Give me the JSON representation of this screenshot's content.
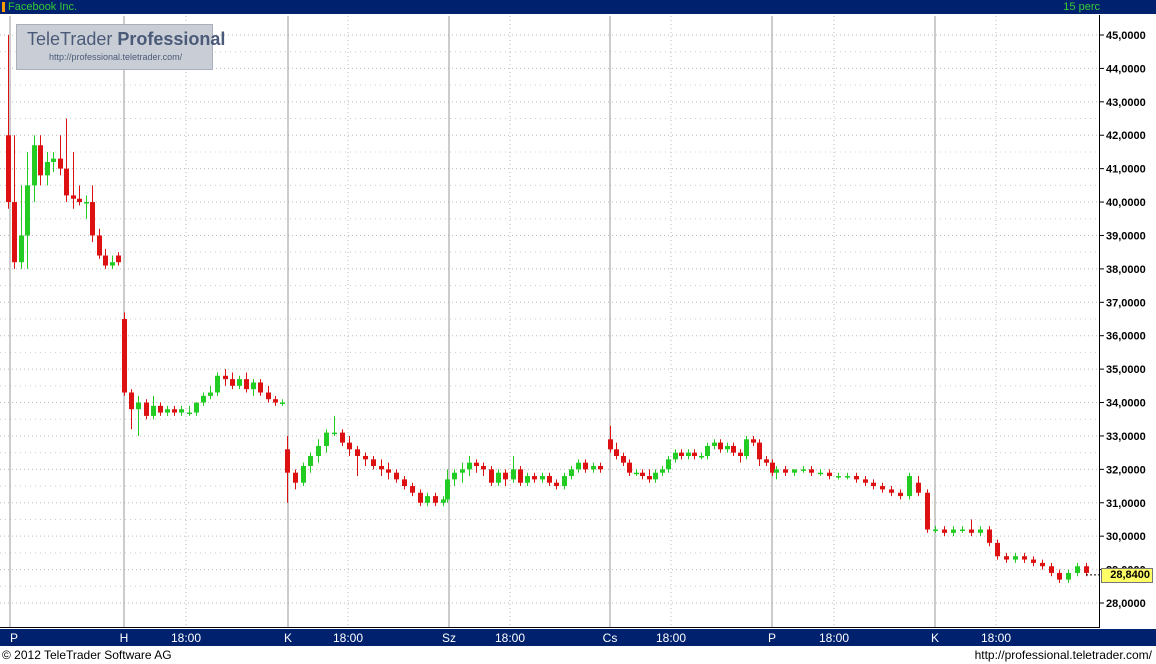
{
  "header": {
    "symbol": "Facebook Inc.",
    "interval": "15 perc"
  },
  "footer": {
    "copyright": "© 2012 TeleTrader Software AG",
    "url": "http://professional.teletrader.com/"
  },
  "logo": {
    "brand_light": "TeleTrader",
    "brand_bold": "Professional",
    "url": "http://professional.teletrader.com/"
  },
  "colors": {
    "frame": "#00226e",
    "up": "#22cc22",
    "down": "#dd1111",
    "label": "#33cc33",
    "last_bg": "#ffff66"
  },
  "chart_data": {
    "type": "candlestick",
    "title": "Facebook Inc.",
    "interval": "15 perc",
    "ylim": [
      27.3,
      45.4
    ],
    "y_ticks": [
      "45,0000",
      "44,0000",
      "43,0000",
      "42,0000",
      "41,0000",
      "40,0000",
      "39,0000",
      "38,0000",
      "37,0000",
      "36,0000",
      "35,0000",
      "34,0000",
      "33,0000",
      "32,0000",
      "31,0000",
      "30,0000",
      "29,0000",
      "28,0000"
    ],
    "x_labels": [
      "P",
      "H",
      "18:00",
      "K",
      "18:00",
      "Sz",
      "18:00",
      "Cs",
      "18:00",
      "P",
      "18:00",
      "K",
      "18:00"
    ],
    "last_value": "28,8400",
    "grid": true,
    "ohlc": [
      [
        42.0,
        45.0,
        39.8,
        40.0
      ],
      [
        40.0,
        42.0,
        38.0,
        38.2
      ],
      [
        38.2,
        40.5,
        38.0,
        39.0
      ],
      [
        39.0,
        41.5,
        38.0,
        40.5
      ],
      [
        40.5,
        42.0,
        40.0,
        41.7
      ],
      [
        41.7,
        42.0,
        40.5,
        40.8
      ],
      [
        40.8,
        41.5,
        40.5,
        41.2
      ],
      [
        41.2,
        41.5,
        40.9,
        41.3
      ],
      [
        41.3,
        42.0,
        40.8,
        41.0
      ],
      [
        41.0,
        42.5,
        40.0,
        40.2
      ],
      [
        40.2,
        41.5,
        39.8,
        40.1
      ],
      [
        40.1,
        40.5,
        39.9,
        40.0
      ],
      [
        40.0,
        40.2,
        39.5,
        40.0
      ],
      [
        40.0,
        40.5,
        38.8,
        39.0
      ],
      [
        39.0,
        39.2,
        38.3,
        38.4
      ],
      [
        38.4,
        38.6,
        38.0,
        38.1
      ],
      [
        38.1,
        38.4,
        38.0,
        38.2
      ],
      [
        38.4,
        38.5,
        38.1,
        38.2
      ],
      [
        36.5,
        36.7,
        34.2,
        34.3
      ],
      [
        34.3,
        34.4,
        33.2,
        33.8
      ],
      [
        33.8,
        34.2,
        33.0,
        34.0
      ],
      [
        34.0,
        34.1,
        33.5,
        33.6
      ],
      [
        33.6,
        34.2,
        33.5,
        33.9
      ],
      [
        33.9,
        34.0,
        33.6,
        33.7
      ],
      [
        33.7,
        33.9,
        33.6,
        33.8
      ],
      [
        33.8,
        33.9,
        33.6,
        33.7
      ],
      [
        33.7,
        33.9,
        33.6,
        33.8
      ],
      [
        33.7,
        33.9,
        33.6,
        33.7
      ],
      [
        33.7,
        34.0,
        33.6,
        34.0
      ],
      [
        34.0,
        34.3,
        33.9,
        34.2
      ],
      [
        34.2,
        34.5,
        34.1,
        34.3
      ],
      [
        34.3,
        34.9,
        34.2,
        34.8
      ],
      [
        34.8,
        35.0,
        34.5,
        34.7
      ],
      [
        34.7,
        34.9,
        34.4,
        34.5
      ],
      [
        34.5,
        34.8,
        34.4,
        34.7
      ],
      [
        34.7,
        34.9,
        34.3,
        34.4
      ],
      [
        34.4,
        34.7,
        34.2,
        34.6
      ],
      [
        34.6,
        34.7,
        34.2,
        34.3
      ],
      [
        34.3,
        34.5,
        34.0,
        34.1
      ],
      [
        34.1,
        34.2,
        33.9,
        34.0
      ],
      [
        34.0,
        34.1,
        33.9,
        34.0
      ],
      [
        32.6,
        33.0,
        31.0,
        31.9
      ],
      [
        31.9,
        32.0,
        31.4,
        31.6
      ],
      [
        31.6,
        32.2,
        31.5,
        32.1
      ],
      [
        32.1,
        32.5,
        31.9,
        32.4
      ],
      [
        32.4,
        32.9,
        32.2,
        32.7
      ],
      [
        32.7,
        33.2,
        32.5,
        33.1
      ],
      [
        33.1,
        33.6,
        33.0,
        33.1
      ],
      [
        33.1,
        33.2,
        32.7,
        32.8
      ],
      [
        32.8,
        33.0,
        32.4,
        32.6
      ],
      [
        32.6,
        32.7,
        31.8,
        32.4
      ],
      [
        32.4,
        32.5,
        32.1,
        32.3
      ],
      [
        32.3,
        32.4,
        32.0,
        32.1
      ],
      [
        32.1,
        32.3,
        31.8,
        32.0
      ],
      [
        32.0,
        32.2,
        31.7,
        31.9
      ],
      [
        31.9,
        32.0,
        31.6,
        31.7
      ],
      [
        31.7,
        31.8,
        31.4,
        31.5
      ],
      [
        31.5,
        31.6,
        31.2,
        31.3
      ],
      [
        31.3,
        31.4,
        30.9,
        31.0
      ],
      [
        31.0,
        31.3,
        30.9,
        31.2
      ],
      [
        31.2,
        31.3,
        30.9,
        31.0
      ],
      [
        31.0,
        31.2,
        30.9,
        31.1
      ],
      [
        31.1,
        32.0,
        31.0,
        31.7
      ],
      [
        31.7,
        32.0,
        31.5,
        31.9
      ],
      [
        31.9,
        32.2,
        31.6,
        32.0
      ],
      [
        32.0,
        32.4,
        31.8,
        32.2
      ],
      [
        32.2,
        32.3,
        31.9,
        32.1
      ],
      [
        32.1,
        32.2,
        31.8,
        32.0
      ],
      [
        32.0,
        32.1,
        31.5,
        31.6
      ],
      [
        31.6,
        32.0,
        31.5,
        31.9
      ],
      [
        31.9,
        32.0,
        31.5,
        31.7
      ],
      [
        31.7,
        32.4,
        31.6,
        32.0
      ],
      [
        32.0,
        32.1,
        31.5,
        31.6
      ],
      [
        31.6,
        31.9,
        31.5,
        31.8
      ],
      [
        31.8,
        31.9,
        31.6,
        31.7
      ],
      [
        31.7,
        31.9,
        31.6,
        31.8
      ],
      [
        31.8,
        31.9,
        31.5,
        31.6
      ],
      [
        31.6,
        31.7,
        31.4,
        31.5
      ],
      [
        31.5,
        31.9,
        31.4,
        31.8
      ],
      [
        31.8,
        32.1,
        31.7,
        32.0
      ],
      [
        32.0,
        32.3,
        31.9,
        32.2
      ],
      [
        32.2,
        32.3,
        31.9,
        32.0
      ],
      [
        32.0,
        32.2,
        31.9,
        32.1
      ],
      [
        32.1,
        32.2,
        31.9,
        32.0
      ],
      [
        32.9,
        33.3,
        32.5,
        32.6
      ],
      [
        32.6,
        32.8,
        32.3,
        32.4
      ],
      [
        32.4,
        32.5,
        32.1,
        32.2
      ],
      [
        32.2,
        32.3,
        31.8,
        31.9
      ],
      [
        31.9,
        32.0,
        31.8,
        31.9
      ],
      [
        31.9,
        32.0,
        31.7,
        31.8
      ],
      [
        31.8,
        32.0,
        31.6,
        31.7
      ],
      [
        31.7,
        32.0,
        31.6,
        31.9
      ],
      [
        31.9,
        32.1,
        31.8,
        32.0
      ],
      [
        32.0,
        32.4,
        31.9,
        32.3
      ],
      [
        32.3,
        32.6,
        32.2,
        32.5
      ],
      [
        32.5,
        32.6,
        32.3,
        32.4
      ],
      [
        32.4,
        32.6,
        32.3,
        32.5
      ],
      [
        32.5,
        32.6,
        32.3,
        32.4
      ],
      [
        32.4,
        32.5,
        32.3,
        32.4
      ],
      [
        32.4,
        32.8,
        32.3,
        32.7
      ],
      [
        32.7,
        32.9,
        32.6,
        32.8
      ],
      [
        32.8,
        32.9,
        32.5,
        32.6
      ],
      [
        32.6,
        32.8,
        32.5,
        32.7
      ],
      [
        32.7,
        32.8,
        32.4,
        32.5
      ],
      [
        32.5,
        32.6,
        32.2,
        32.4
      ],
      [
        32.4,
        33.0,
        32.3,
        32.9
      ],
      [
        32.9,
        33.0,
        32.7,
        32.8
      ],
      [
        32.8,
        32.9,
        32.1,
        32.3
      ],
      [
        32.3,
        32.4,
        32.1,
        32.2
      ],
      [
        32.2,
        32.3,
        31.8,
        31.9
      ],
      [
        31.9,
        32.1,
        31.7,
        32.0
      ],
      [
        32.0,
        32.1,
        31.8,
        31.9
      ],
      [
        31.9,
        32.0,
        31.8,
        32.0
      ],
      [
        32.0,
        32.1,
        31.9,
        32.0
      ],
      [
        32.0,
        32.1,
        31.8,
        31.9
      ],
      [
        31.9,
        32.0,
        31.8,
        31.9
      ],
      [
        31.9,
        32.0,
        31.7,
        31.8
      ],
      [
        31.8,
        31.9,
        31.7,
        31.8
      ],
      [
        31.8,
        31.9,
        31.7,
        31.8
      ],
      [
        31.8,
        31.9,
        31.6,
        31.7
      ],
      [
        31.7,
        31.8,
        31.5,
        31.6
      ],
      [
        31.6,
        31.7,
        31.4,
        31.5
      ],
      [
        31.5,
        31.6,
        31.3,
        31.4
      ],
      [
        31.4,
        31.5,
        31.2,
        31.3
      ],
      [
        31.3,
        31.4,
        31.1,
        31.2
      ],
      [
        31.2,
        31.9,
        31.1,
        31.8
      ],
      [
        31.6,
        31.8,
        31.2,
        31.3
      ],
      [
        31.3,
        31.4,
        30.1,
        30.2
      ],
      [
        30.2,
        30.3,
        30.1,
        30.2
      ],
      [
        30.2,
        30.3,
        30.0,
        30.1
      ],
      [
        30.1,
        30.3,
        30.0,
        30.2
      ],
      [
        30.2,
        30.3,
        30.1,
        30.2
      ],
      [
        30.2,
        30.5,
        30.0,
        30.1
      ],
      [
        30.1,
        30.3,
        30.0,
        30.2
      ],
      [
        30.2,
        30.3,
        29.7,
        29.8
      ],
      [
        29.8,
        29.9,
        29.3,
        29.4
      ],
      [
        29.4,
        29.5,
        29.2,
        29.3
      ],
      [
        29.3,
        29.5,
        29.2,
        29.4
      ],
      [
        29.4,
        29.5,
        29.2,
        29.3
      ],
      [
        29.3,
        29.4,
        29.1,
        29.2
      ],
      [
        29.2,
        29.3,
        29.0,
        29.1
      ],
      [
        29.1,
        29.2,
        28.8,
        28.9
      ],
      [
        28.9,
        29.0,
        28.6,
        28.7
      ],
      [
        28.7,
        29.0,
        28.6,
        28.9
      ],
      [
        28.9,
        29.2,
        28.8,
        29.1
      ],
      [
        29.1,
        29.2,
        28.8,
        28.9
      ],
      [
        28.9,
        29.0,
        28.7,
        28.8
      ],
      [
        28.8,
        29.1,
        28.7,
        29.0
      ],
      [
        29.0,
        29.3,
        28.9,
        29.2
      ],
      [
        29.2,
        29.3,
        28.7,
        28.84
      ]
    ]
  }
}
